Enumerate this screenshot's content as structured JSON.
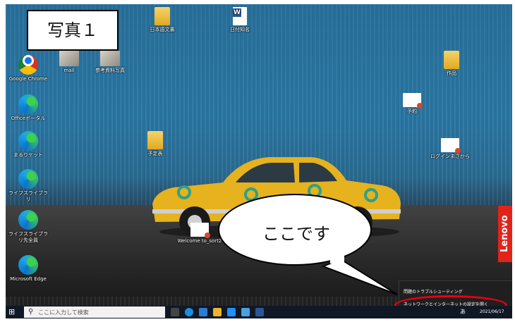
{
  "photo_label": "写真１",
  "callout_text": "ここです",
  "desktop_icons": [
    {
      "name": "Google Chrome",
      "label": "Google Chrome"
    },
    {
      "name": "mail",
      "label": "mail"
    },
    {
      "name": "shashin",
      "label": "参考資料写真"
    },
    {
      "name": "office",
      "label": "Officeポータル"
    },
    {
      "name": "marugo",
      "label": "まるりケット"
    },
    {
      "name": "life1",
      "label": "ライフスライブラリ"
    },
    {
      "name": "life2",
      "label": "ライフスライブラリ先全員"
    },
    {
      "name": "msedge",
      "label": "Microsoft Edge"
    },
    {
      "name": "folder1",
      "label": "日本語文書"
    },
    {
      "name": "worddoc",
      "label": "日付知名"
    },
    {
      "name": "folder2",
      "label": "予定表"
    },
    {
      "name": "note1",
      "label": "予約"
    },
    {
      "name": "note2",
      "label": "ログインまさから"
    },
    {
      "name": "folder3",
      "label": "作品"
    },
    {
      "name": "welcome",
      "label": "Welcome to_sort2"
    }
  ],
  "tray_menu": {
    "item1": "問題のトラブルシューティング",
    "item2": "ネットワークとインターネットの設定を開く"
  },
  "taskbar": {
    "search_placeholder": "ここに入力して検索",
    "clock": "2021/06/17",
    "ime": "あ"
  },
  "brand": "Lenovo",
  "colors": {
    "accent_red": "#e60012",
    "taskbar": "#101826"
  }
}
